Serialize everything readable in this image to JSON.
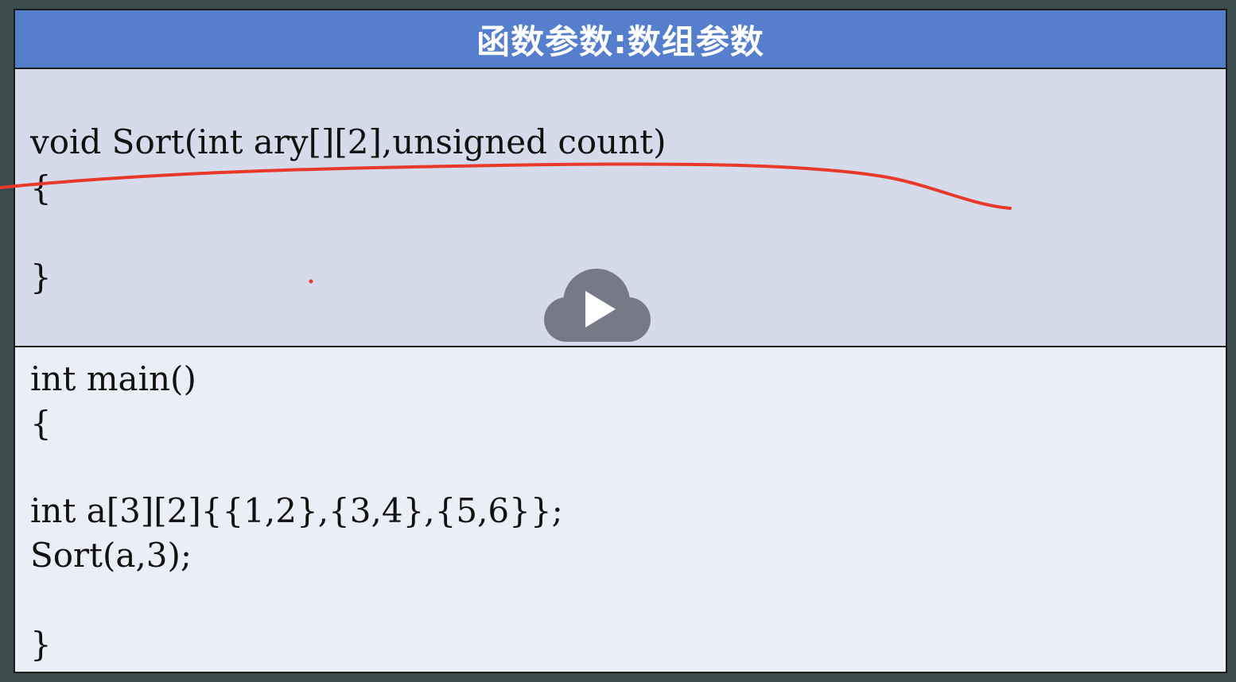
{
  "slide": {
    "title": "函数参数:数组参数"
  },
  "sort_function": {
    "signature": "void Sort(int ary[][2],unsigned count)",
    "open_brace": "{",
    "close_brace": "}"
  },
  "main_function": {
    "signature": "int main()",
    "open_brace": "{",
    "array_decl": "int a[3][2]{{1,2},{3,4},{5,6}};",
    "sort_call": "Sort(a,3);",
    "close_brace": "}"
  },
  "annotation": {
    "pen_color": "#e8392b"
  },
  "video": {
    "overlay_icon": "play-cloud-icon",
    "overlay_color": "#757a86"
  }
}
